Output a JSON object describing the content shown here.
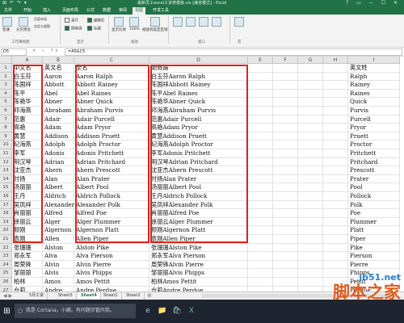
{
  "window": {
    "title": "最新员工excel工资表模板.xls [兼容模式] - Excel",
    "quick_access": "⊞ ↶ ↷ ▾",
    "controls": "? ▭ − ☐ ✕"
  },
  "ribbon_tabs": [
    "文件",
    "开始",
    "插入",
    "页面布局",
    "公式",
    "数据",
    "审阅",
    "视图",
    "开发工具"
  ],
  "active_tab_index": 7,
  "ribbon": {
    "workbook_views": [
      "普通",
      "分页预览",
      "页面布局",
      "自定义视图"
    ],
    "show": [
      "直尺",
      "编辑栏",
      "网格线",
      "标题"
    ],
    "group_labels": [
      "工作簿视图",
      "显示",
      "缩放",
      "窗口",
      "宏"
    ],
    "zoom_buttons": [
      "显示比例",
      "100%",
      "缩放到选定区域"
    ]
  },
  "formula_bar": {
    "name_box": "D5",
    "buttons": "✕ ✓ fx",
    "formula": "=A5&C5"
  },
  "columns": [
    "A",
    "B",
    "C",
    "D",
    "E",
    "F",
    "G",
    "H",
    "I"
  ],
  "rows": [
    {
      "n": "1",
      "a": "中文名",
      "b": "英文名",
      "c": "全名",
      "d": "源数据",
      "i": "英文姓"
    },
    {
      "n": "2",
      "a": "白玉芬",
      "b": "Aaron",
      "c": "Aaron Ralph",
      "d": "白玉芬Aaron Ralph",
      "i": "Ralph"
    },
    {
      "n": "3",
      "a": "陈国祥",
      "b": "Abbott",
      "c": "Abbott Rainey",
      "d": "陈国祥Abbott Rainey",
      "i": "Rainey"
    },
    {
      "n": "4",
      "a": "陈平",
      "b": "Abel",
      "c": "Abel Raines",
      "d": "陈平Abel Raines",
      "i": "Raines"
    },
    {
      "n": "5",
      "a": "陈艳华",
      "b": "Abner",
      "c": "Abner Quick",
      "d": "陈艳华Abner Quick",
      "i": "Quick"
    },
    {
      "n": "6",
      "a": "邓海燕",
      "b": "Abraham",
      "c": "Abraham Purvis",
      "d": "邓海燕Abraham Purvis",
      "i": "Purvis"
    },
    {
      "n": "7",
      "a": "范惠",
      "b": "Adair",
      "c": "Adair Purcell",
      "d": "范惠Adair Purcell",
      "i": "Purcell"
    },
    {
      "n": "8",
      "a": "高艳",
      "b": "Adam",
      "c": "Adam Pryor",
      "d": "高艳Adam Pryor",
      "i": "Pryor"
    },
    {
      "n": "9",
      "a": "黄慧",
      "b": "Addison",
      "c": "Addison Pruett",
      "d": "黄慧Addison Pruett",
      "i": "Pruett"
    },
    {
      "n": "10",
      "a": "纪海燕",
      "b": "Adolph",
      "c": "Adolph Proctor",
      "d": "纪海燕Adolph Proctor",
      "i": "Proctor"
    },
    {
      "n": "11",
      "a": "李军",
      "b": "Adonis",
      "c": "Adonis Pritchett",
      "d": "李军Adonis Pritchett",
      "i": "Pritchett"
    },
    {
      "n": "12",
      "a": "明汉琴",
      "b": "Adrian",
      "c": "Adrian Pritchard",
      "d": "明汉琴Adrian Pritchard",
      "i": "Pritchard"
    },
    {
      "n": "13",
      "a": "沈亚杰",
      "b": "Ahern",
      "c": "Ahern Prescott",
      "d": "沈亚杰Ahern Prescott",
      "i": "Prescott"
    },
    {
      "n": "14",
      "a": "时扬",
      "b": "Alan",
      "c": "Alan Prater",
      "d": "时扬Alan Prater",
      "i": "Prater"
    },
    {
      "n": "15",
      "a": "汤丽丽",
      "b": "Albert",
      "c": "Albert Pool",
      "d": "汤丽丽Albert Pool",
      "i": "Pool"
    },
    {
      "n": "16",
      "a": "王丹",
      "b": "Aldrich",
      "c": "Aldrich Pollock",
      "d": "王丹Aldrich Pollock",
      "i": "Pollock"
    },
    {
      "n": "17",
      "a": "吴凤祥",
      "b": "Alexander",
      "c": "Alexander Polk",
      "d": "吴凤祥Alexander Polk",
      "i": "Polk"
    },
    {
      "n": "18",
      "a": "肖丽丽",
      "b": "Alfred",
      "c": "Alfred Poe",
      "d": "肖丽丽Alfred Poe",
      "i": "Poe"
    },
    {
      "n": "19",
      "a": "徐丽云",
      "b": "Alger",
      "c": "Alger Plummer",
      "d": "徐丽云Alger Plummer",
      "i": "Plummer"
    },
    {
      "n": "20",
      "a": "颜刚",
      "b": "Algernon",
      "c": "Algernon Platt",
      "d": "颜刚Algernon Platt",
      "i": "Platt"
    },
    {
      "n": "21",
      "a": "袁刚",
      "b": "Allen",
      "c": "Allen Piper",
      "d": "袁刚Allen Piper",
      "i": "Piper"
    },
    {
      "n": "22",
      "a": "张珊珊",
      "b": "Alston",
      "c": "Alston Pike",
      "d": "张珊珊Alston Pike",
      "i": "Pike"
    },
    {
      "n": "23",
      "a": "郑永军",
      "b": "Alva",
      "c": "Alva Pierson",
      "d": "郑永军Alva Pierson",
      "i": "Pierson"
    },
    {
      "n": "24",
      "a": "周荣锋",
      "b": "Alvin",
      "c": "Alvin Pierre",
      "d": "周荣锋Alvin Pierre",
      "i": "Pierre"
    },
    {
      "n": "25",
      "a": "邹丽丽",
      "b": "Alvis",
      "c": "Alvis Phipps",
      "d": "邹丽丽Alvis Phipps",
      "i": "Phipps"
    },
    {
      "n": "26",
      "a": "柏林",
      "b": "Amos",
      "c": "Amos Pettit",
      "d": "柏林Amos Pettit",
      "i": "Pettit"
    },
    {
      "n": "27",
      "a": "仓莉",
      "b": "Andre",
      "c": "Andre Perdue",
      "d": "仓莉Andre Perdue",
      "i": "Perdue"
    }
  ],
  "sheet_tabs": [
    "5月工资",
    "Sheet3",
    "Sheet4",
    "Sheet1",
    "Sheet2"
  ],
  "active_sheet_index": 2,
  "sheet_nav": "◀ ▶",
  "add_sheet": "⊕",
  "taskbar": {
    "start_icon": "⊞",
    "search_text": "我是 Cortana，小娜。有问题尽管问我。",
    "apps": [
      "e",
      "📁",
      "🛍",
      "X"
    ]
  },
  "watermark": {
    "line1": "jb51.net",
    "line2": "脚本之家"
  },
  "colors": {
    "excel_green": "#217346",
    "highlight_red": "#e02020"
  }
}
